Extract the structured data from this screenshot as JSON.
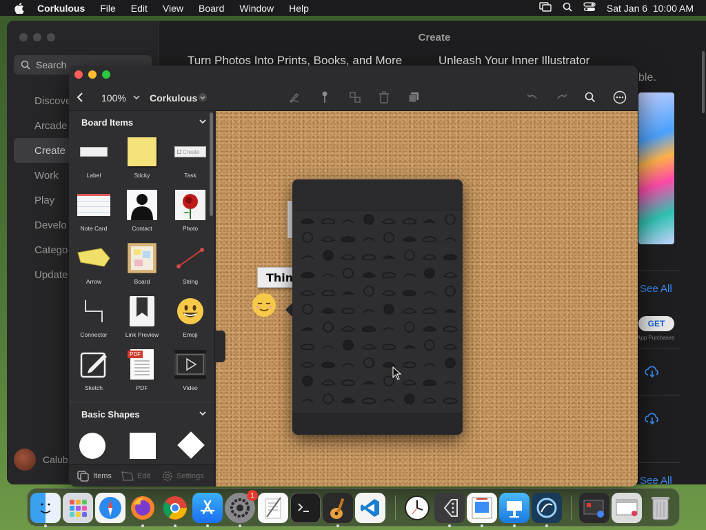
{
  "menubar": {
    "app_name": "Corkulous",
    "menus": [
      "File",
      "Edit",
      "View",
      "Board",
      "Window",
      "Help"
    ],
    "datetime": "Sat Jan 6  10:00 AM"
  },
  "appstore": {
    "window_title": "Create",
    "search_placeholder": "Search",
    "nav": [
      "Discover",
      "Arcade",
      "Create",
      "Work",
      "Play",
      "Develop",
      "Categories",
      "Updates"
    ],
    "nav_visible": [
      "Discove",
      "Arcade",
      "Create",
      "Work",
      "Play",
      "Develo",
      "Catego",
      "Update"
    ],
    "user": "Calub",
    "headline_left": "Turn Photos Into Prints, Books, and More",
    "headline_right": "Unleash Your Inner Illustrator",
    "partial_text": "ble.",
    "see_all": "See All",
    "get_button": "GET",
    "in_app": "App Purchases"
  },
  "corkulous": {
    "zoom": "100%",
    "board_name": "Corkulous",
    "sidebar": {
      "section_board_items": "Board Items",
      "section_basic_shapes": "Basic Shapes",
      "items": [
        {
          "label": "Label",
          "icon": "label-icon"
        },
        {
          "label": "Sticky",
          "icon": "sticky-icon"
        },
        {
          "label": "Task",
          "icon": "task-icon"
        },
        {
          "label": "Note Card",
          "icon": "note-card-icon"
        },
        {
          "label": "Contact",
          "icon": "contact-icon"
        },
        {
          "label": "Photo",
          "icon": "photo-icon"
        },
        {
          "label": "Arrow",
          "icon": "arrow-icon"
        },
        {
          "label": "Board",
          "icon": "board-icon"
        },
        {
          "label": "String",
          "icon": "string-icon"
        },
        {
          "label": "Connector",
          "icon": "connector-icon"
        },
        {
          "label": "Link Preview",
          "icon": "link-preview-icon"
        },
        {
          "label": "Emoji",
          "icon": "emoji-icon"
        },
        {
          "label": "Sketch",
          "icon": "sketch-icon"
        },
        {
          "label": "PDF",
          "icon": "pdf-icon"
        },
        {
          "label": "Video",
          "icon": "video-icon"
        }
      ],
      "task_thumb_text": "Create",
      "pdf_thumb_text": "PDF",
      "bottom_tabs": [
        "Items",
        "Edit",
        "Settings"
      ]
    },
    "board": {
      "label_text": "Think"
    }
  },
  "dock": {
    "apps": [
      "Finder",
      "Launchpad",
      "Safari",
      "Firefox",
      "Chrome",
      "App Store",
      "System Settings",
      "TextEdit",
      "Terminal",
      "GarageBand",
      "Visual Studio Code",
      "Clock",
      "Xcode Editor",
      "Remote Desktop",
      "Keynote",
      "Corkulous",
      "Recent Apps",
      "Preview",
      "Trash"
    ],
    "settings_badge": "1"
  },
  "colors": {
    "close": "#fe5f57",
    "minimize": "#febc2e",
    "zoom": "#28c840",
    "link": "#3a8ef6"
  }
}
